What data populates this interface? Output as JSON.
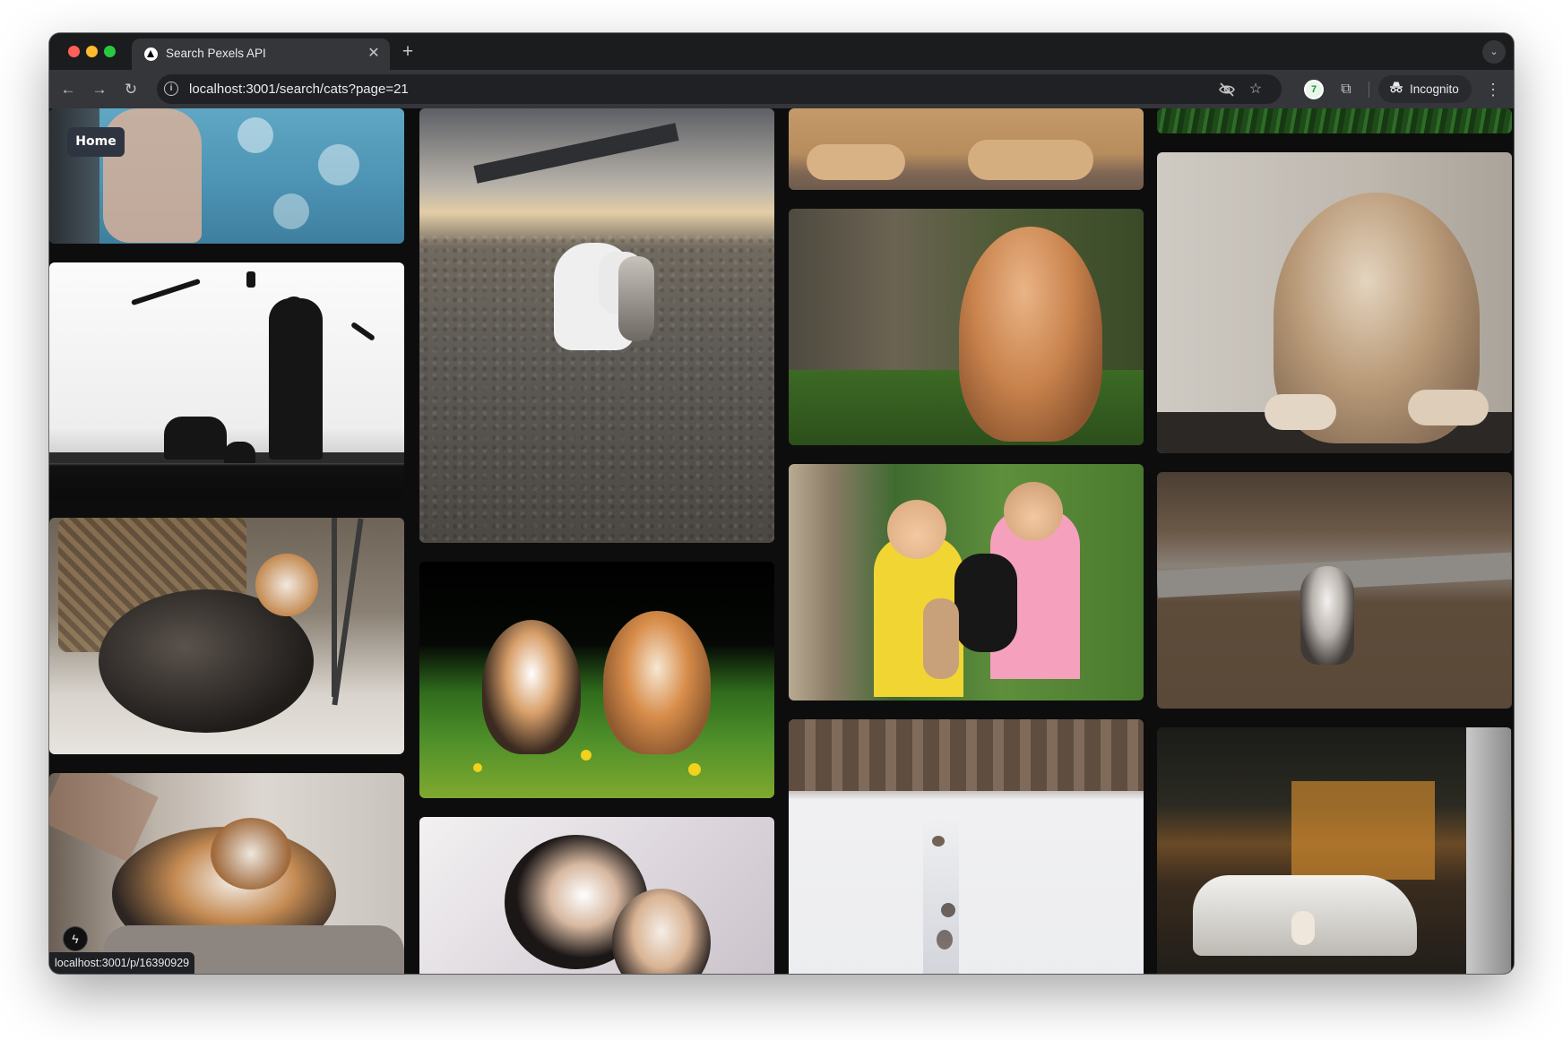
{
  "browser": {
    "tab": {
      "title": "Search Pexels API",
      "close_glyph": "✕",
      "favicon": "triangle-icon"
    },
    "new_tab_glyph": "+",
    "tab_search_glyph": "⌄",
    "nav": {
      "back_glyph": "←",
      "forward_glyph": "→",
      "reload_glyph": "↻"
    },
    "address": {
      "url": "localhost:3001/search/cats?page=21",
      "info_glyph": "i"
    },
    "omnibox_icons": {
      "eye_off": "eye-off-icon",
      "bookmark": "☆"
    },
    "extension_badge": "7",
    "extensions_glyph": "⧉",
    "incognito_label": "Incognito",
    "incognito_glyph": "🕶",
    "menu_glyph": "⋮"
  },
  "page": {
    "home_label": "Home",
    "status_url": "localhost:3001/p/16390929",
    "bolt_glyph": "ϟ"
  },
  "photos": [
    {
      "name": "photo-woman-cat-print-shirt",
      "alt": "Person wearing blue shirt with cat print"
    },
    {
      "name": "photo-silhouette-man-cats-birds",
      "alt": "Silhouette of man, cats and birds"
    },
    {
      "name": "photo-cats-near-basket",
      "alt": "Cats lying near a wicker basket"
    },
    {
      "name": "photo-calico-cat-petted",
      "alt": "Calico cat being petted"
    },
    {
      "name": "photo-two-cats-gravel",
      "alt": "Two cats walking on gravel"
    },
    {
      "name": "photo-two-kittens-grass",
      "alt": "Two kittens in grass"
    },
    {
      "name": "photo-kittens-blanket",
      "alt": "Kittens on a blanket"
    },
    {
      "name": "photo-lion-paws",
      "alt": "Big cat paws on ground"
    },
    {
      "name": "photo-orange-tabby",
      "alt": "Orange tabby cat"
    },
    {
      "name": "photo-kids-holding-cats",
      "alt": "Two children holding cats"
    },
    {
      "name": "photo-cats-in-snow",
      "alt": "Cats walking in snow"
    },
    {
      "name": "photo-grass-strip",
      "alt": "Grass"
    },
    {
      "name": "photo-tabby-on-wall",
      "alt": "Tabby cat resting on wall"
    },
    {
      "name": "photo-cat-walking-lawn",
      "alt": "Cat walking on lawn"
    },
    {
      "name": "photo-cats-on-white-car",
      "alt": "Cats on a white car"
    }
  ],
  "colors": {
    "page_bg": "#0d0d0d",
    "tab_active": "#35363a",
    "toolbar": "#35363a",
    "omnibox": "#202124",
    "home_button": "#2f3540"
  }
}
